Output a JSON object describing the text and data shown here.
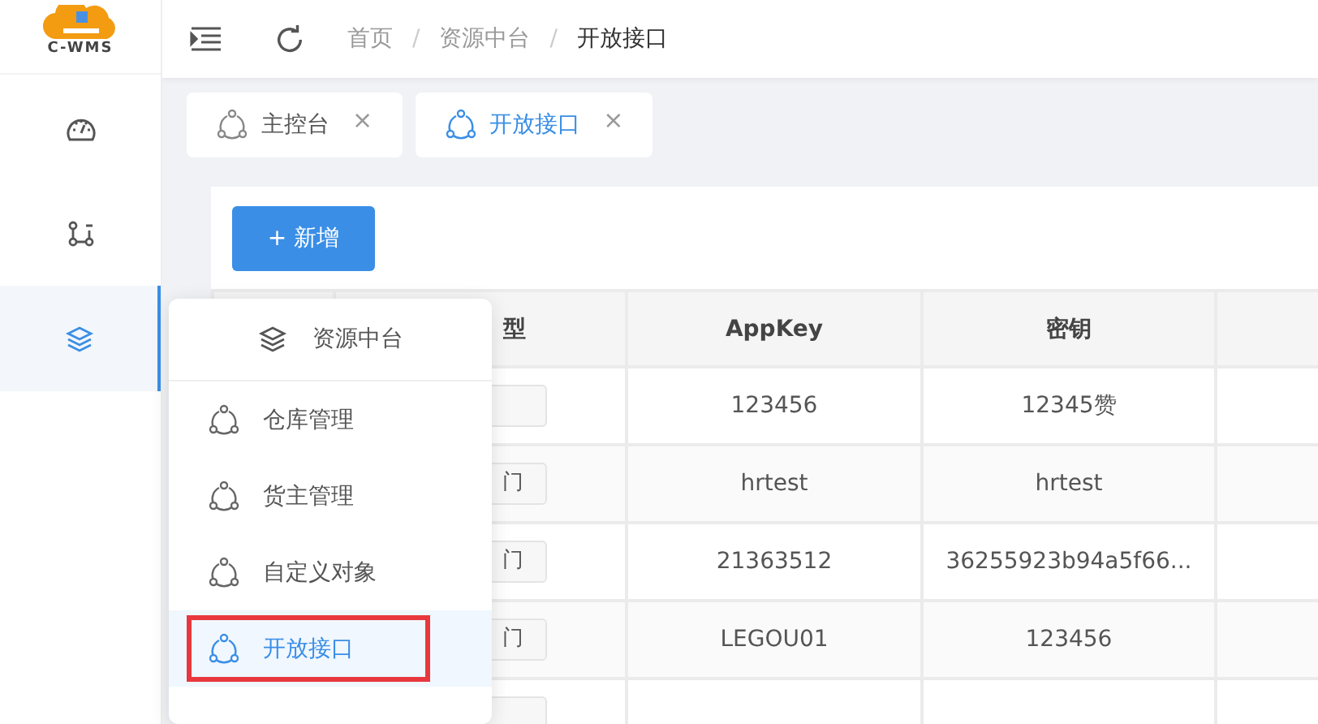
{
  "logo": {
    "text": "C-WMS"
  },
  "sidebar": {
    "items": [
      {
        "selected": false
      },
      {
        "selected": false
      },
      {
        "selected": true
      }
    ]
  },
  "header": {
    "breadcrumb": [
      "首页",
      "资源中台",
      "开放接口"
    ],
    "separator": "/"
  },
  "tabs": [
    {
      "label": "主控台",
      "close": "×",
      "selected": false
    },
    {
      "label": "开放接口",
      "close": "×",
      "selected": true
    }
  ],
  "toolbar": {
    "add_button": "+ 新增"
  },
  "table": {
    "columns": [
      "型",
      "AppKey",
      "密钥"
    ],
    "rows": [
      {
        "appkey": "123456",
        "secret": "12345赞"
      },
      {
        "type": "门",
        "appkey": "hrtest",
        "secret": "hrtest"
      },
      {
        "type": "门",
        "appkey": "21363512",
        "secret": "36255923b94a5f66..."
      },
      {
        "type": "门",
        "appkey": "LEGOU01",
        "secret": "123456"
      }
    ]
  },
  "popup_menu": {
    "title": "资源中台",
    "items": [
      {
        "label": "仓库管理",
        "selected": false,
        "annotated": false
      },
      {
        "label": "货主管理",
        "selected": false,
        "annotated": false
      },
      {
        "label": "自定义对象",
        "selected": false,
        "annotated": false
      },
      {
        "label": "开放接口",
        "selected": true,
        "annotated": true
      }
    ]
  }
}
